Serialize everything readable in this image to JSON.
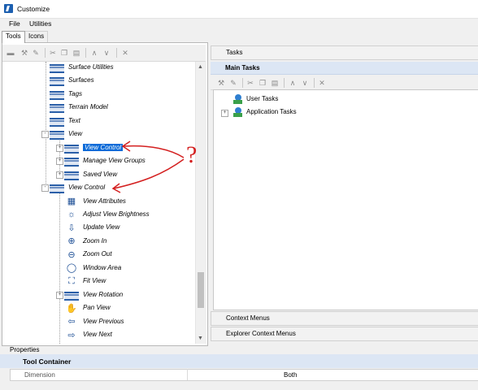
{
  "window": {
    "title": "Customize"
  },
  "menu": {
    "items": [
      "File",
      "Utilities"
    ]
  },
  "tabs": [
    "Tools",
    "Icons"
  ],
  "left_tree": {
    "items": [
      {
        "label": "Surface Utilities",
        "icon": "folder-icon"
      },
      {
        "label": "Surfaces",
        "icon": "folder-icon"
      },
      {
        "label": "Tags",
        "icon": "folder-icon"
      },
      {
        "label": "Terrain Model",
        "icon": "folder-icon"
      },
      {
        "label": "Text",
        "icon": "folder-icon"
      },
      {
        "label": "View",
        "icon": "folder-icon"
      },
      {
        "label": "View Control",
        "icon": "folder-icon",
        "selected": true
      },
      {
        "label": "Manage View Groups",
        "icon": "folder-icon"
      },
      {
        "label": "Saved View",
        "icon": "folder-icon"
      },
      {
        "label": "View Control",
        "icon": "folder-icon"
      },
      {
        "label": "View Attributes",
        "icon": "view-attributes-icon"
      },
      {
        "label": "Adjust View Brightness",
        "icon": "brightness-icon"
      },
      {
        "label": "Update View",
        "icon": "update-view-icon"
      },
      {
        "label": "Zoom In",
        "icon": "zoom-in-icon"
      },
      {
        "label": "Zoom Out",
        "icon": "zoom-out-icon"
      },
      {
        "label": "Window Area",
        "icon": "window-area-icon"
      },
      {
        "label": "Fit View",
        "icon": "fit-view-icon"
      },
      {
        "label": "View Rotation",
        "icon": "folder-icon"
      },
      {
        "label": "Pan View",
        "icon": "pan-hand-icon"
      },
      {
        "label": "View Previous",
        "icon": "arrow-left-icon"
      },
      {
        "label": "View Next",
        "icon": "arrow-right-icon"
      }
    ]
  },
  "right": {
    "tasks_header": "Tasks",
    "main_tasks": "Main Tasks",
    "task_items": [
      "User Tasks",
      "Application Tasks"
    ],
    "context_menus": "Context Menus",
    "explorer_context_menus": "Explorer Context Menus"
  },
  "properties": {
    "label": "Properties",
    "section": "Tool Container",
    "rows": [
      {
        "key": "Dimension",
        "value": "Both"
      }
    ]
  },
  "annotation": {
    "text": "?",
    "color": "#d42020"
  },
  "colors": {
    "selection": "#0a6ad8",
    "header": "#dce6f4"
  }
}
